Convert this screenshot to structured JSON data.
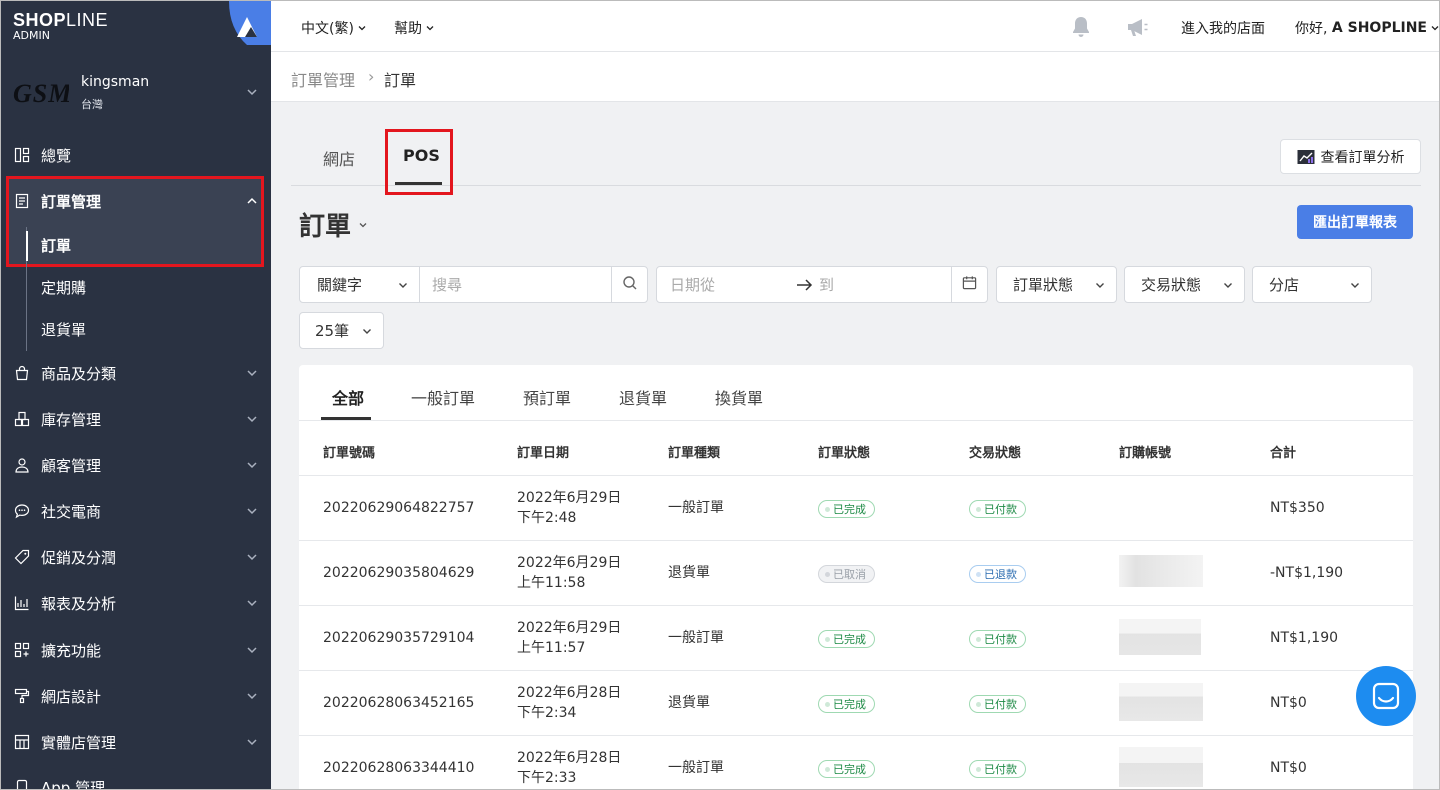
{
  "brand": {
    "logo_bold": "SHOP",
    "logo_thin": "LINE",
    "sub": "ADMIN"
  },
  "shop": {
    "logo_text": "GSM",
    "name": "kingsman",
    "region": "台灣"
  },
  "sidebar": {
    "items": [
      {
        "label": "總覽",
        "icon": "dashboard-icon"
      },
      {
        "label": "訂單管理",
        "icon": "order-doc-icon"
      },
      {
        "label": "商品及分類",
        "icon": "bag-icon"
      },
      {
        "label": "庫存管理",
        "icon": "inventory-icon"
      },
      {
        "label": "顧客管理",
        "icon": "user-icon"
      },
      {
        "label": "社交電商",
        "icon": "chat-bubble-icon"
      },
      {
        "label": "促銷及分潤",
        "icon": "tag-icon"
      },
      {
        "label": "報表及分析",
        "icon": "chart-icon"
      },
      {
        "label": "擴充功能",
        "icon": "apps-icon"
      },
      {
        "label": "網店設計",
        "icon": "paint-roller-icon"
      },
      {
        "label": "實體店管理",
        "icon": "store-icon"
      },
      {
        "label": "App 管理",
        "icon": "app-icon"
      }
    ],
    "order_sub": [
      "訂單",
      "定期購",
      "退貨單"
    ]
  },
  "topbar": {
    "language": "中文(繁)",
    "help": "幫助",
    "visit_store": "進入我的店面",
    "greeting_prefix": "你好, ",
    "greeting_name": "A SHOPLINE"
  },
  "breadcrumb": {
    "parent": "訂單管理",
    "separator": "›",
    "current": "訂單"
  },
  "channel_tabs": [
    "網店",
    "POS"
  ],
  "analysis_button": "查看訂單分析",
  "page_title": "訂單",
  "export_button": "匯出訂單報表",
  "filters": {
    "keyword_select": "關鍵字",
    "search_placeholder": "搜尋",
    "date_from_placeholder": "日期從",
    "date_to_placeholder": "到",
    "order_status": "訂單狀態",
    "payment_status": "交易狀態",
    "branch": "分店",
    "per_page": "25筆"
  },
  "order_tabs": [
    "全部",
    "一般訂單",
    "預訂單",
    "退貨單",
    "換貨單"
  ],
  "table": {
    "headers": [
      "訂單號碼",
      "訂單日期",
      "訂單種類",
      "訂單狀態",
      "交易狀態",
      "訂購帳號",
      "合計"
    ],
    "rows": [
      {
        "id": "20220629064822757",
        "date": "2022年6月29日",
        "time": "下午2:48",
        "type": "一般訂單",
        "status": "已完成",
        "payment": "已付款",
        "total": "NT$350"
      },
      {
        "id": "20220629035804629",
        "date": "2022年6月29日",
        "time": "上午11:58",
        "type": "退貨單",
        "status": "已取消",
        "payment": "已退款",
        "total": "-NT$1,190"
      },
      {
        "id": "20220629035729104",
        "date": "2022年6月29日",
        "time": "上午11:57",
        "type": "一般訂單",
        "status": "已完成",
        "payment": "已付款",
        "total": "NT$1,190"
      },
      {
        "id": "20220628063452165",
        "date": "2022年6月28日",
        "time": "下午2:34",
        "type": "退貨單",
        "status": "已完成",
        "payment": "已付款",
        "total": "NT$0"
      },
      {
        "id": "20220628063344410",
        "date": "2022年6月28日",
        "time": "下午2:33",
        "type": "一般訂單",
        "status": "已完成",
        "payment": "已付款",
        "total": "NT$0"
      }
    ]
  },
  "colors": {
    "sidebar_bg": "#2a3242",
    "accent_blue": "#4a7ee6",
    "highlight_red": "#e3161e",
    "chat_blue": "#1d8cf0"
  }
}
